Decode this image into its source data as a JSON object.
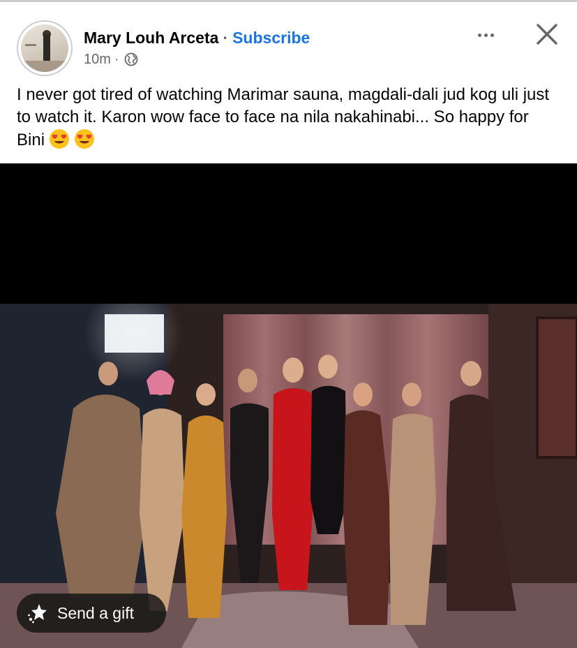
{
  "post": {
    "author": "Mary Louh Arceta",
    "separator": "·",
    "subscribe_label": "Subscribe",
    "timestamp": "10m",
    "meta_separator": "·",
    "audience_icon": "globe-icon",
    "body_text": "I never got tired of watching Marimar sauna, magdali-dali jud kog uli just to watch it. Karon wow face to face na nila nakahinabi... So happy for Bini",
    "body_emojis": [
      "heart-eyes-emoji",
      "heart-eyes-emoji"
    ]
  },
  "header_actions": {
    "more_icon": "more-horizontal-icon",
    "close_icon": "close-icon"
  },
  "media": {
    "gift_button_label": "Send a gift",
    "gift_icon": "gift-sparkle-icon"
  },
  "colors": {
    "link_blue": "#1b74e4",
    "secondary_text": "#65676b",
    "primary_text": "#050505"
  }
}
